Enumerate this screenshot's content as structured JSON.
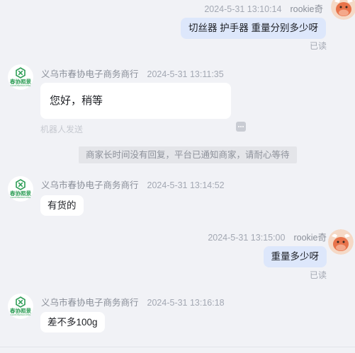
{
  "messages": {
    "m1": {
      "time": "2024-5-31 13:10:14",
      "sender": "rookie奇",
      "text": "切丝器 护手器 重量分别多少呀",
      "status": "已读"
    },
    "m2": {
      "sender": "义乌市春协电子商务商行",
      "time": "2024-5-31 13:11:35",
      "text": "您好，稍等",
      "hint": "机器人发送"
    },
    "notice": "商家长时间没有回复，平台已通知商家，请耐心等待",
    "m3": {
      "sender": "义乌市春协电子商务商行",
      "time": "2024-5-31 13:14:52",
      "text": "有货的"
    },
    "m4": {
      "time": "2024-5-31 13:15:00",
      "sender": "rookie奇",
      "text": "重量多少呀",
      "status": "已读"
    },
    "m5": {
      "sender": "义乌市春协电子商务商行",
      "time": "2024-5-31 13:16:18",
      "text": "差不多100g"
    }
  },
  "shop_avatar": {
    "logo_text": "春协照景",
    "sub_text": "CHUNXIEZHAOJING",
    "icon": "hexagon-x-logo"
  },
  "user_avatar": {
    "icon": "cartoon-bull-avatar"
  },
  "colors": {
    "background": "#f1f2f6",
    "outgoing_bubble": "#dde7fb",
    "incoming_bubble": "#ffffff",
    "shop_green": "#2f9e57",
    "user_avatar_orange": "#e8734a"
  }
}
